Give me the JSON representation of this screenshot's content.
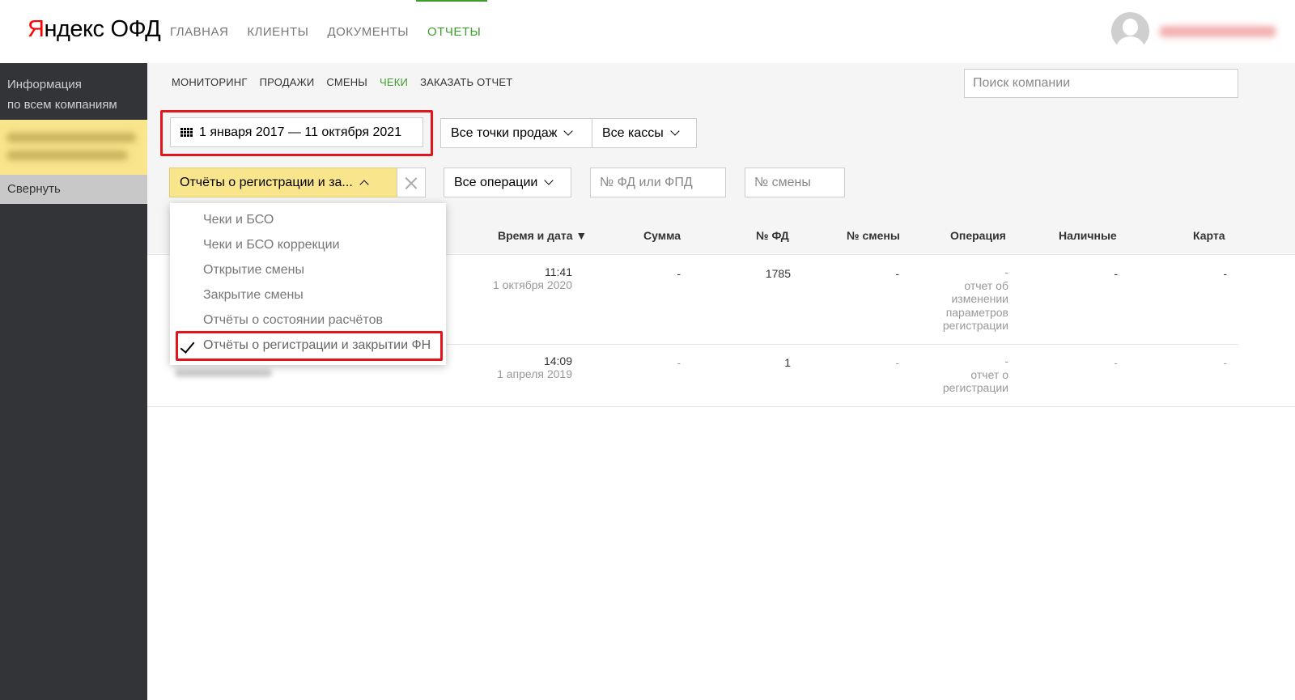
{
  "header": {
    "logo_first": "Я",
    "logo_rest": "ндекс",
    "logo_ofd": "ОФД",
    "nav": [
      "ГЛАВНАЯ",
      "КЛИЕНТЫ",
      "ДОКУМЕНТЫ",
      "ОТЧЕТЫ"
    ],
    "active_nav": "ОТЧЕТЫ"
  },
  "sidebar": {
    "title_line1": "Информация",
    "title_line2": "по всем компаниям",
    "collapse_label": "Свернуть"
  },
  "subnav": {
    "items": [
      "МОНИТОРИНГ",
      "ПРОДАЖИ",
      "СМЕНЫ",
      "ЧЕКИ",
      "ЗАКАЗАТЬ ОТЧЕТ"
    ],
    "active": "ЧЕКИ",
    "search_placeholder": "Поиск компании"
  },
  "filters": {
    "date_range": "1 января 2017 — 11 октября 2021",
    "points": "Все точки продаж",
    "cashboxes": "Все кассы",
    "doc_type": "Отчёты о регистрации и за...",
    "operations": "Все операции",
    "fd_placeholder": "№ ФД или ФПД",
    "shift_placeholder": "№  смены"
  },
  "dropdown": {
    "options": [
      "Чеки и БСО",
      "Чеки и БСО коррекции",
      "Открытие смены",
      "Закрытие смены",
      "Отчёты о состоянии расчётов",
      "Отчёты о регистрации и закрытии ФН"
    ],
    "selected": "Отчёты о регистрации и закрытии ФН"
  },
  "table": {
    "columns": [
      "Время и дата ▼",
      "Сумма",
      "№ ФД",
      "№ смены",
      "Операция",
      "Наличные",
      "Карта"
    ],
    "rows": [
      {
        "time": "11:41",
        "date": "1 октября 2020",
        "sum": "-",
        "fd": "1785",
        "shift": "-",
        "operation": "-",
        "operation_desc": [
          "отчет об",
          "изменении",
          "параметров",
          "регистрации"
        ],
        "cash": "-",
        "card": "-"
      },
      {
        "time": "14:09",
        "date": "1 апреля 2019",
        "sum": "-",
        "fd": "1",
        "shift": "-",
        "operation": "-",
        "operation_desc": [
          "отчет о",
          "регистрации"
        ],
        "cash": "-",
        "card": "-"
      }
    ]
  },
  "colors": {
    "accent_green": "#3e9d2b",
    "highlight_yellow": "#f8e58c",
    "annotation_red": "#e0161c",
    "sidebar_dark": "#333438"
  }
}
